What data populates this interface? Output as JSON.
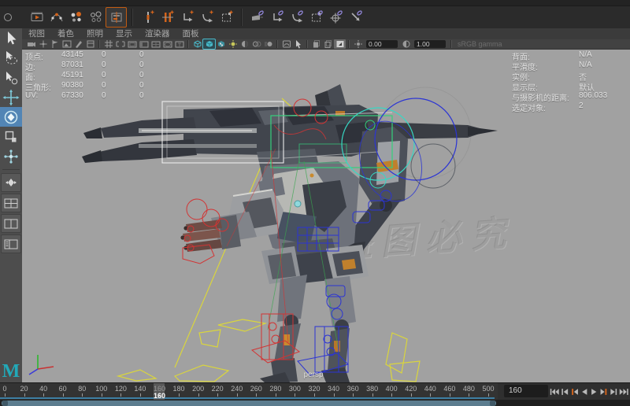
{
  "colors": {
    "accent_orange": "#d3641c",
    "accent_purple": "#9186d8",
    "accent_teal": "#49b8c8",
    "active_blue": "#5285b5",
    "viewport_bg": "#a1a1a1",
    "cached_line": "#3d7ea3"
  },
  "top_toolbar": {
    "items": [
      {
        "t": "icon",
        "name": "playblast-icon",
        "kind": "film"
      },
      {
        "t": "icon",
        "name": "motion-trail-icon",
        "kind": "curve"
      },
      {
        "t": "icon",
        "name": "set-key-dots-icon",
        "kind": "dots"
      },
      {
        "t": "icon",
        "name": "ghost-frames-icon",
        "kind": "dotso"
      },
      {
        "t": "icon",
        "name": "time-editor-icon",
        "kind": "track",
        "selected": true
      },
      {
        "t": "sep"
      },
      {
        "t": "icon",
        "name": "insert-key-icon",
        "kind": "key1",
        "accent": "orange"
      },
      {
        "t": "icon",
        "name": "insert-keys-icon",
        "kind": "key2",
        "accent": "orange"
      },
      {
        "t": "icon",
        "name": "move-keys-icon",
        "kind": "arrl",
        "accent": "orange"
      },
      {
        "t": "icon",
        "name": "rotate-keys-icon",
        "kind": "arrc",
        "accent": "orange"
      },
      {
        "t": "icon",
        "name": "scale-key-region-icon",
        "kind": "boxd",
        "accent": "orange"
      },
      {
        "t": "sep"
      },
      {
        "t": "icon",
        "name": "parent-constraint-icon",
        "kind": "slide",
        "accent": "purple"
      },
      {
        "t": "icon",
        "name": "point-constraint-icon",
        "kind": "arrl",
        "accent": "purple"
      },
      {
        "t": "icon",
        "name": "orient-constraint-icon",
        "kind": "arrc",
        "accent": "purple"
      },
      {
        "t": "icon",
        "name": "scale-constraint-icon",
        "kind": "boxd",
        "accent": "purple"
      },
      {
        "t": "icon",
        "name": "aim-constraint-icon",
        "kind": "cross",
        "accent": "purple"
      },
      {
        "t": "icon",
        "name": "pole-vector-constraint-icon",
        "kind": "arrd",
        "accent": "purple"
      }
    ]
  },
  "toolbox": {
    "tools": [
      {
        "name": "select-tool",
        "kind": "select"
      },
      {
        "name": "lasso-select-tool",
        "kind": "lasso"
      },
      {
        "name": "paint-select-tool",
        "kind": "paint"
      },
      {
        "name": "move-tool",
        "kind": "move"
      },
      {
        "name": "rotate-tool",
        "kind": "rotate",
        "active": true
      },
      {
        "name": "scale-tool",
        "kind": "scale"
      },
      {
        "name": "universal-manipulator-tool",
        "kind": "axis"
      }
    ],
    "layouts": [
      {
        "name": "layout-single-pane-button",
        "kind": "pane1"
      },
      {
        "name": "layout-four-pane-button",
        "kind": "pane4"
      },
      {
        "name": "layout-two-pane-button",
        "kind": "pane2"
      },
      {
        "name": "layout-outliner-pane-button",
        "kind": "paneol"
      }
    ],
    "logo": "M"
  },
  "panel_menu": {
    "items": [
      "视图",
      "着色",
      "照明",
      "显示",
      "渲染器",
      "面板"
    ]
  },
  "viewport_toolbar": {
    "exposure_value": "0.00",
    "gamma_value": "1.00",
    "colorspace_label": "sRGB gamma",
    "items": [
      {
        "t": "icon",
        "name": "select-camera-icon",
        "kind": "cam"
      },
      {
        "t": "icon",
        "name": "2d-pan-zoom-icon",
        "kind": "pan"
      },
      {
        "t": "icon",
        "name": "bookmark-icon",
        "kind": "flag"
      },
      {
        "t": "icon",
        "name": "image-plane-icon",
        "kind": "img"
      },
      {
        "t": "icon",
        "name": "grease-pencil-icon",
        "kind": "pen"
      },
      {
        "t": "icon",
        "name": "camera-attributes-icon",
        "kind": "attr"
      },
      {
        "t": "sep"
      },
      {
        "t": "icon",
        "name": "grid-icon",
        "kind": "grid"
      },
      {
        "t": "icon",
        "name": "film-gate-icon",
        "kind": "gate"
      },
      {
        "t": "icon",
        "name": "resolution-gate-icon",
        "kind": "resg"
      },
      {
        "t": "icon",
        "name": "gate-mask-icon",
        "kind": "mask"
      },
      {
        "t": "icon",
        "name": "field-chart-icon",
        "kind": "field"
      },
      {
        "t": "icon",
        "name": "safe-action-icon",
        "kind": "safea"
      },
      {
        "t": "icon",
        "name": "safe-title-icon",
        "kind": "safet"
      },
      {
        "t": "sep"
      },
      {
        "t": "icon",
        "name": "wireframe-icon",
        "kind": "wire"
      },
      {
        "t": "icon",
        "name": "smooth-shade-icon",
        "kind": "shade",
        "active": true
      },
      {
        "t": "icon",
        "name": "textured-icon",
        "kind": "tex"
      },
      {
        "t": "icon",
        "name": "use-all-lights-icon",
        "kind": "light"
      },
      {
        "t": "icon",
        "name": "shadows-icon",
        "kind": "shadow"
      },
      {
        "t": "icon",
        "name": "screen-space-ao-icon",
        "kind": "ao"
      },
      {
        "t": "icon",
        "name": "motion-blur-icon",
        "kind": "mblur"
      },
      {
        "t": "sep"
      },
      {
        "t": "icon",
        "name": "xray-icon",
        "kind": "xray"
      },
      {
        "t": "icon",
        "name": "isolate-select-icon",
        "kind": "iso"
      },
      {
        "t": "sep"
      },
      {
        "t": "icon",
        "name": "snapshot-icon",
        "kind": "page"
      },
      {
        "t": "icon",
        "name": "sequence-snapshot-icon",
        "kind": "page2"
      },
      {
        "t": "icon",
        "name": "render-view-pane-icon",
        "kind": "panea",
        "activelight": true
      },
      {
        "t": "sep"
      },
      {
        "t": "icon",
        "name": "exposure-icon",
        "kind": "expo"
      },
      {
        "t": "field",
        "name": "exposure-field",
        "bind": "exposure_value"
      },
      {
        "t": "icon",
        "name": "gamma-icon",
        "kind": "gam"
      },
      {
        "t": "field",
        "name": "gamma-field",
        "bind": "gamma_value"
      },
      {
        "t": "sep"
      },
      {
        "t": "label",
        "name": "colorspace-label",
        "bind": "colorspace_label"
      }
    ]
  },
  "hud": {
    "left_rows": [
      {
        "label": "顶点:",
        "total": "43145",
        "c2": "0",
        "c3": "0"
      },
      {
        "label": "边:",
        "total": "87031",
        "c2": "0",
        "c3": "0"
      },
      {
        "label": "面:",
        "total": "45191",
        "c2": "0",
        "c3": "0"
      },
      {
        "label": "三角形:",
        "total": "90380",
        "c2": "0",
        "c3": "0"
      },
      {
        "label": "UV:",
        "total": "67330",
        "c2": "0",
        "c3": "0"
      }
    ],
    "right_rows": [
      {
        "label": "背面:",
        "value": "N/A"
      },
      {
        "label": "平滑度:",
        "value": "N/A"
      },
      {
        "label": "实例:",
        "value": "否"
      },
      {
        "label": "显示层:",
        "value": "默认"
      },
      {
        "label": "与摄影机的距离:",
        "value": "806.033"
      },
      {
        "label": "选定对象:",
        "value": "2"
      }
    ]
  },
  "viewport": {
    "camera_label": "persp",
    "watermark": "盗图必究"
  },
  "timeline": {
    "tick_frames": [
      0,
      20,
      40,
      60,
      80,
      100,
      120,
      140,
      160,
      180,
      200,
      220,
      240,
      260,
      280,
      300,
      320,
      340,
      360,
      380,
      400,
      420,
      440,
      460,
      480,
      500
    ],
    "current_frame": "160",
    "frame_field_value": "160",
    "playback_buttons": [
      {
        "name": "go-to-start-button",
        "kind": "start"
      },
      {
        "name": "step-back-frame-button",
        "kind": "fback"
      },
      {
        "name": "step-back-key-button",
        "kind": "kback"
      },
      {
        "name": "play-backward-button",
        "kind": "pback"
      },
      {
        "name": "play-forward-button",
        "kind": "play"
      },
      {
        "name": "step-forward-key-button",
        "kind": "kfwd"
      },
      {
        "name": "step-forward-frame-button",
        "kind": "ffwd"
      },
      {
        "name": "go-to-end-button",
        "kind": "end"
      }
    ]
  }
}
